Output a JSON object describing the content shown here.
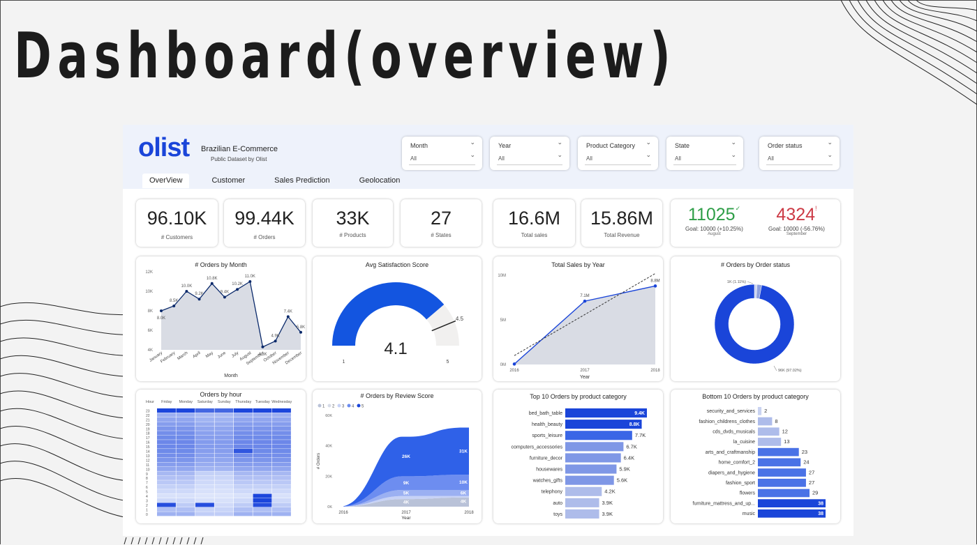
{
  "slide_title": "Dashboard(overview)",
  "brand": {
    "logo": "olist",
    "title": "Brazilian E-Commerce",
    "subtitle": "Public Dataset by Olist"
  },
  "tabs": [
    "OverView",
    "Customer",
    "Sales Prediction",
    "Geolocation"
  ],
  "slicers": [
    {
      "label": "Month",
      "value": "All"
    },
    {
      "label": "Year",
      "value": "All"
    },
    {
      "label": "Product Category",
      "value": "All"
    },
    {
      "label": "State",
      "value": "All"
    },
    {
      "label": "Order status",
      "value": "All"
    }
  ],
  "kpis": [
    {
      "value": "96.10K",
      "label": "# Customers"
    },
    {
      "value": "99.44K",
      "label": "# Orders"
    },
    {
      "value": "33K",
      "label": "# Products"
    },
    {
      "value": "27",
      "label": "# States"
    },
    {
      "value": "16.6M",
      "label": "Total sales"
    },
    {
      "value": "15.86M",
      "label": "Total Revenue"
    }
  ],
  "goals": [
    {
      "value": "11025",
      "mark": "✓",
      "goal": "Goal: 10000 (+10.25%)",
      "period": "August",
      "color": "#2e9e47"
    },
    {
      "value": "4324",
      "mark": "!",
      "goal": "Goal: 10000 (-56.76%)",
      "period": "September",
      "color": "#cc3a45"
    }
  ],
  "colors": {
    "accent": "#1a45d9",
    "bar_light": "#aebcea",
    "area": "#d9dce4"
  },
  "chart_data": [
    {
      "type": "area",
      "title": "# Orders by Month",
      "xlabel": "Month",
      "categories": [
        "January",
        "February",
        "March",
        "April",
        "May",
        "June",
        "July",
        "August",
        "September",
        "October",
        "November",
        "December"
      ],
      "values": [
        8.0,
        8.5,
        10.0,
        9.2,
        10.8,
        9.4,
        10.2,
        11.0,
        4.3,
        4.9,
        7.4,
        5.8
      ],
      "data_labels": [
        "8.0K",
        "8.5K",
        "10.0K",
        "9.2K",
        "10.8K",
        "9.4K",
        "10.2K",
        "11.0K",
        "4.3K",
        "4.9K",
        "7.4K",
        "5.8K"
      ],
      "yticks": [
        "4K",
        "6K",
        "8K",
        "10K",
        "12K"
      ],
      "ylim": [
        4,
        12
      ]
    },
    {
      "type": "gauge",
      "title": "Avg Satisfaction Score",
      "value": "4.1",
      "target": "4.5",
      "min": "1",
      "max": "5"
    },
    {
      "type": "area",
      "title": "Total Sales by Year",
      "xlabel": "Year",
      "categories": [
        "2016",
        "2017",
        "2018"
      ],
      "values": [
        0.05,
        7.1,
        8.8
      ],
      "data_labels": [
        "",
        "7.1M",
        "8.8M"
      ],
      "yticks": [
        "0M",
        "5M",
        "10M"
      ],
      "ylim": [
        0,
        10
      ],
      "trend": true
    },
    {
      "type": "pie",
      "title": "# Orders by Order status",
      "slices": [
        {
          "label": "96K (97.02%)",
          "value": 97.02
        },
        {
          "label": "1K (1.11%)",
          "value": 1.11
        },
        {
          "value": 1.87
        }
      ]
    },
    {
      "type": "heatmap",
      "title": "Orders by hour",
      "corner": "Hour",
      "columns": [
        "Friday",
        "Monday",
        "Saturday",
        "Sunday",
        "Thursday",
        "Tuesday",
        "Wednesday"
      ],
      "rows": [
        "23",
        "22",
        "21",
        "20",
        "19",
        "18",
        "17",
        "16",
        "15",
        "14",
        "13",
        "12",
        "11",
        "10",
        "9",
        "8",
        "7",
        "6",
        "5",
        "4",
        "3",
        "2",
        "1",
        "0"
      ]
    },
    {
      "type": "area",
      "title": "# Orders by Review Score",
      "ylabel": "# Orders",
      "xlabel": "Year",
      "legend": [
        "1",
        "2",
        "3",
        "4",
        "5"
      ],
      "categories": [
        "2016",
        "2017",
        "2018"
      ],
      "yticks": [
        "0K",
        "20K",
        "40K",
        "60K"
      ],
      "ylim": [
        0,
        60
      ],
      "series": [
        {
          "name": "5",
          "values": [
            0.2,
            26,
            31
          ]
        },
        {
          "name": "4",
          "values": [
            0.1,
            9,
            10
          ]
        },
        {
          "name": "3",
          "values": [
            0,
            4,
            4
          ]
        },
        {
          "name": "2",
          "values": [
            0,
            2,
            1
          ]
        },
        {
          "name": "1",
          "values": [
            0,
            5,
            6
          ]
        }
      ],
      "data_labels_2017": [
        "26K",
        "9K",
        "5K",
        "4K"
      ],
      "data_labels_2018": [
        "31K",
        "10K",
        "6K",
        "4K"
      ]
    },
    {
      "type": "bar",
      "title": "Top 10 Orders by product category",
      "categories": [
        "bed_bath_table",
        "health_beauty",
        "sports_leisure",
        "computers_accessories",
        "furniture_decor",
        "housewares",
        "watches_gifts",
        "telephony",
        "auto",
        "toys"
      ],
      "values": [
        9.4,
        8.8,
        7.7,
        6.7,
        6.4,
        5.9,
        5.6,
        4.2,
        3.9,
        3.9
      ],
      "data_labels": [
        "9.4K",
        "8.8K",
        "7.7K",
        "6.7K",
        "6.4K",
        "5.9K",
        "5.6K",
        "4.2K",
        "3.9K",
        "3.9K"
      ]
    },
    {
      "type": "bar",
      "title": "Bottom 10 Orders by product category",
      "categories": [
        "security_and_services",
        "fashion_childrens_clothes",
        "cds_dvds_musicals",
        "la_cuisine",
        "arts_and_craftmanship",
        "home_comfort_2",
        "diapers_and_hygiene",
        "fashion_sport",
        "flowers",
        "furniture_mattress_and_up...",
        "music"
      ],
      "values": [
        2,
        8,
        12,
        13,
        23,
        24,
        27,
        27,
        29,
        38,
        38
      ],
      "data_labels": [
        "2",
        "8",
        "12",
        "13",
        "23",
        "24",
        "27",
        "27",
        "29",
        "38",
        "38"
      ]
    }
  ]
}
